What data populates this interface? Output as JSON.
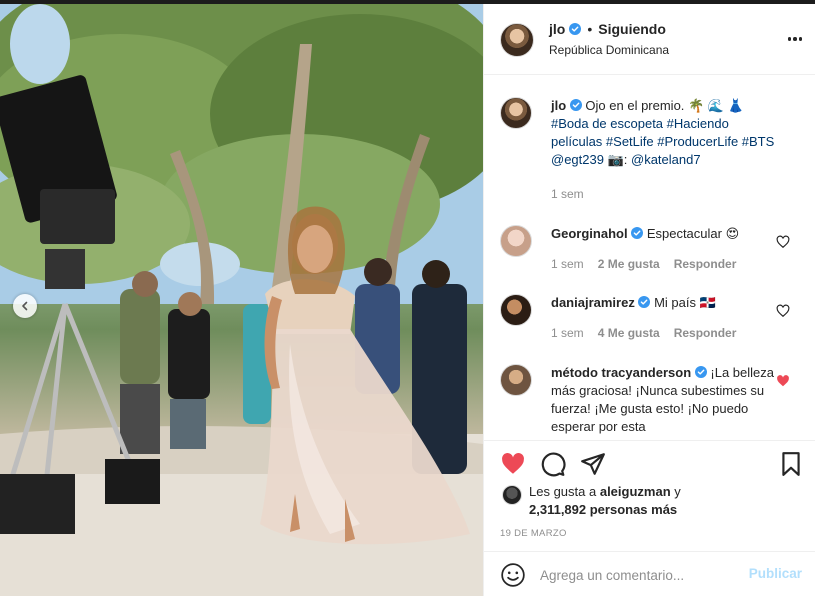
{
  "post": {
    "username": "jlo",
    "follow_status": "Siguiendo",
    "separator": "•",
    "location": "República Dominicana",
    "caption_text": "Ojo en el premio. 🌴 🌊 👗",
    "caption_tags_1": "#Boda de escopeta #Haciendo películas #SetLife #ProducerLife #BTS",
    "caption_tags_2": "@egt239",
    "caption_camera": " 📷: ",
    "caption_tags_3": "@kateland7",
    "caption_time": "1 sem"
  },
  "comments": [
    {
      "username": "Georginahol",
      "text": "Espectacular 😍",
      "time": "1 sem",
      "likes": "2 Me gusta",
      "reply": "Responder",
      "liked": false
    },
    {
      "username": "daniajramirez",
      "text": "Mi país 🇩🇴",
      "time": "1 sem",
      "likes": "4 Me gusta",
      "reply": "Responder",
      "liked": false
    },
    {
      "username": "método tracyanderson",
      "text": "¡La belleza más graciosa! ¡Nunca subestimes su fuerza! ¡Me gusta esto! ¡No puedo esperar por esta",
      "liked": true
    }
  ],
  "likes": {
    "prefix": "Les gusta a",
    "user": "aleiguzman",
    "connector": " y",
    "count": "2,311,892 personas más"
  },
  "date": "19 DE MARZO",
  "add_comment": {
    "placeholder": "Agrega un comentario...",
    "publish": "Publicar"
  },
  "colors": {
    "like_red": "#ed4956",
    "link_blue": "#00376b",
    "publish_disabled": "#b2dffc",
    "verified_blue": "#3897f0"
  },
  "icons": [
    "verified-icon",
    "more-options-icon",
    "heart-icon",
    "comment-icon",
    "share-icon",
    "bookmark-icon",
    "emoji-icon",
    "chevron-left-icon"
  ]
}
